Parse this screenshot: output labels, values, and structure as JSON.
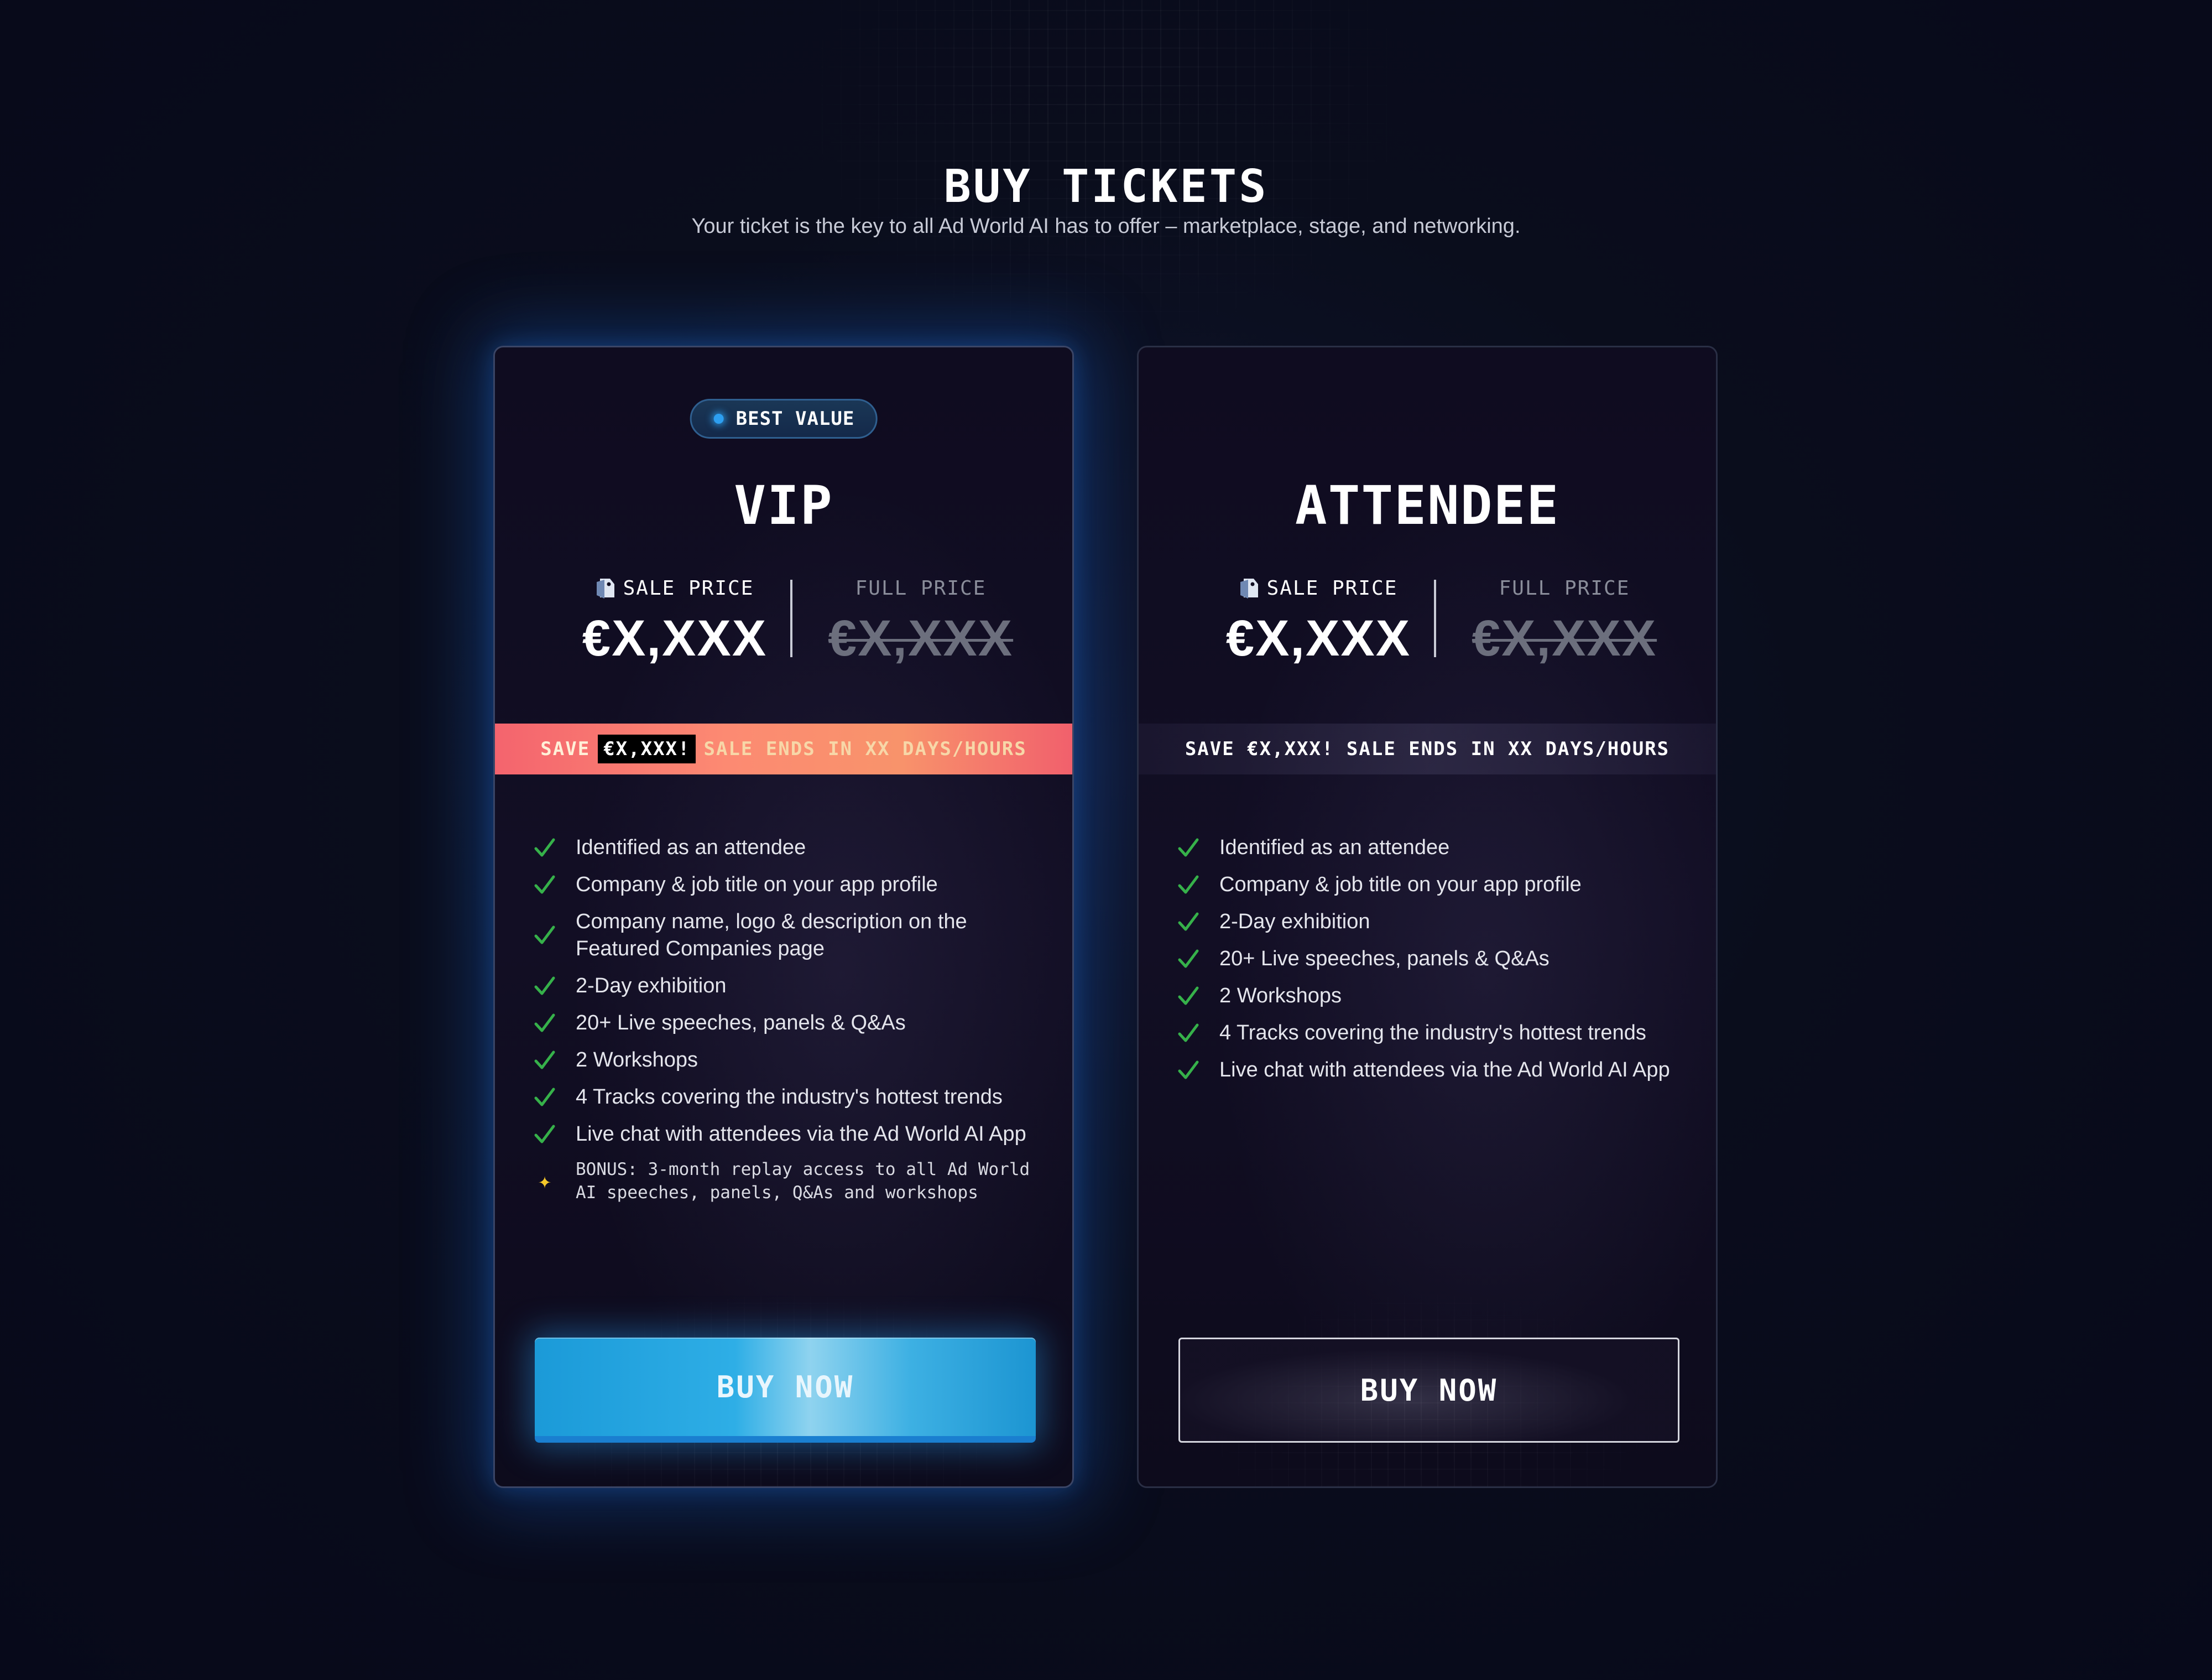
{
  "header": {
    "title": "BUY TICKETS",
    "subtitle": "Your ticket is the key to all Ad World AI has to offer – marketplace, stage, and networking."
  },
  "colors": {
    "accent_blue": "#2eaee6",
    "banner_coral": "#fc8a72",
    "check_green": "#36b14a",
    "bonus_star": "#f5c82a"
  },
  "vip": {
    "badge": "BEST VALUE",
    "name": "VIP",
    "sale_label": "SALE PRICE",
    "sale_price": "€X,XXX",
    "full_label": "FULL PRICE",
    "full_price": "€X,XXX",
    "banner": {
      "save": "SAVE",
      "amount": "€X,XXX!",
      "rest": "SALE ENDS IN XX DAYS/HOURS"
    },
    "features": [
      "Identified as an attendee",
      "Company & job title on your app profile",
      "Company name, logo & description on the Featured Companies page",
      "2-Day exhibition",
      "20+ Live speeches, panels & Q&As",
      "2 Workshops",
      "4 Tracks covering the industry's hottest trends",
      "Live chat with attendees via the Ad World AI App"
    ],
    "bonus": "BONUS: 3-month replay access to all Ad World AI speeches, panels, Q&As and workshops",
    "button": "BUY NOW"
  },
  "attendee": {
    "name": "ATTENDEE",
    "sale_label": "SALE PRICE",
    "sale_price": "€X,XXX",
    "full_label": "FULL PRICE",
    "full_price": "€X,XXX",
    "banner": "SAVE €X,XXX! SALE ENDS IN XX DAYS/HOURS",
    "features": [
      "Identified as an attendee",
      "Company & job title on your app profile",
      "2-Day exhibition",
      "20+ Live speeches, panels & Q&As",
      "2 Workshops",
      "4 Tracks covering the industry's hottest trends",
      "Live chat with attendees via the Ad World AI App"
    ],
    "button": "BUY NOW"
  },
  "icons": {
    "check": "check-icon",
    "star": "sparkle-icon",
    "price_tag": "price-tag-icon",
    "badge_dot": "status-dot-icon"
  }
}
